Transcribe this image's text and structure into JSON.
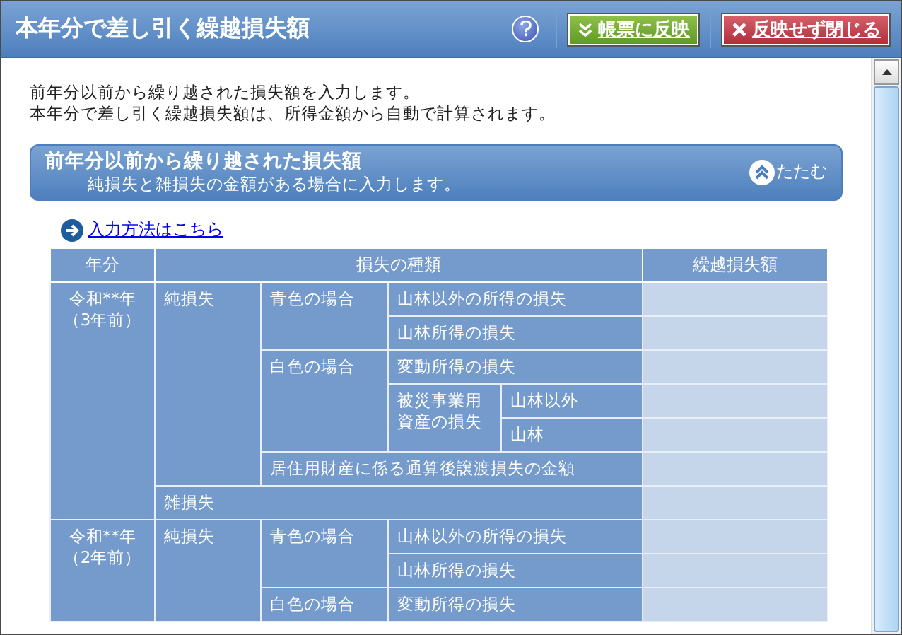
{
  "window": {
    "title": "本年分で差し引く繰越損失額"
  },
  "toolbar": {
    "buttons": [
      {
        "kind": "help"
      },
      {
        "kind": "apply",
        "label": "帳票に反映"
      },
      {
        "kind": "cancel",
        "label": "反映せず閉じる"
      }
    ]
  },
  "intro": [
    "前年分以前から繰り越された損失額を入力します。",
    "本年分で差し引く繰越損失額は、所得金額から自動で計算されます。"
  ],
  "section": {
    "title": "前年分以前から繰り越された損失額",
    "subtitle": "純損失と雑損失の金額がある場合に入力します。",
    "collapse_label": "たたむ"
  },
  "link": "入力方法はこちら",
  "table": {
    "columns": [
      "年分",
      "損失の種類",
      "繰越損失額"
    ],
    "years": [
      {
        "year": "令和**年",
        "ago": "（3年前）",
        "groups": [
          {
            "label": "純損失",
            "children": [
              {
                "label": "青色の場合",
                "children": [
                  {
                    "label": "山林以外の所得の損失"
                  },
                  {
                    "label": "山林所得の損失"
                  }
                ]
              },
              {
                "label": "白色の場合",
                "children": [
                  {
                    "label": "変動所得の損失"
                  },
                  {
                    "label": "被災事業用資産の損失",
                    "children": [
                      {
                        "label": "山林以外"
                      },
                      {
                        "label": "山林"
                      }
                    ]
                  }
                ]
              },
              {
                "label": "居住用財産に係る通算後譲渡損失の金額"
              }
            ]
          },
          {
            "label": "雑損失"
          }
        ]
      },
      {
        "year": "令和**年",
        "ago": "（2年前）",
        "groups": [
          {
            "label": "純損失",
            "children": [
              {
                "label": "青色の場合",
                "children": [
                  {
                    "label": "山林以外の所得の損失"
                  },
                  {
                    "label": "山林所得の損失"
                  }
                ]
              },
              {
                "label": "白色の場合",
                "children": [
                  {
                    "label": "変動所得の損失"
                  }
                ]
              }
            ]
          }
        ]
      }
    ]
  }
}
